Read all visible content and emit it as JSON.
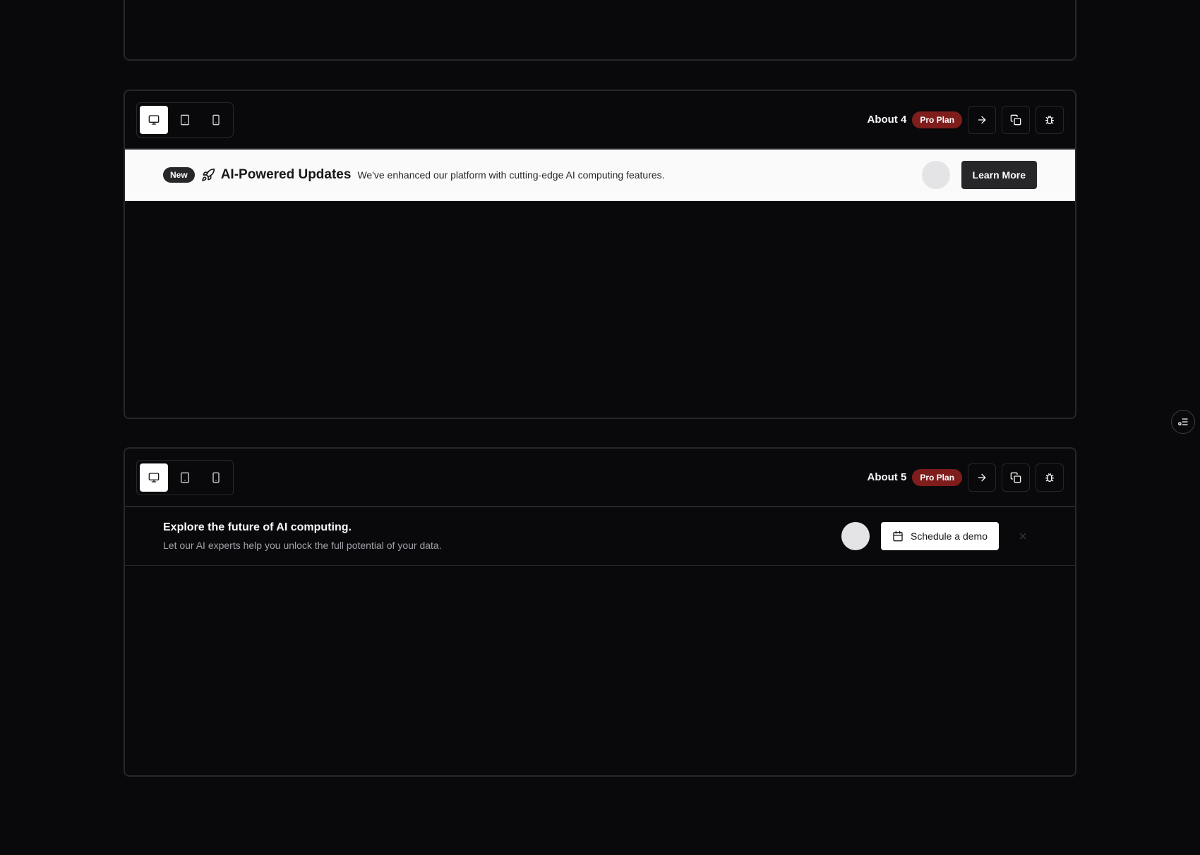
{
  "blocks": [
    {
      "title": "About 4",
      "plan": "Pro Plan",
      "banner": {
        "badge": "New",
        "icon": "rocket-icon",
        "title": "AI-Powered Updates",
        "description": "We've enhanced our platform with cutting-edge AI computing features.",
        "cta": "Learn More"
      }
    },
    {
      "title": "About 5",
      "plan": "Pro Plan",
      "banner": {
        "title": "Explore the future of AI computing.",
        "description": "Let our AI experts help you unlock the full potential of your data.",
        "cta": "Schedule a demo",
        "cta_icon": "calendar-icon"
      }
    }
  ],
  "colors": {
    "background": "#09090b",
    "plan_badge": "#7f1d1d",
    "border": "#27272a",
    "light_banner": "#fafafa"
  }
}
